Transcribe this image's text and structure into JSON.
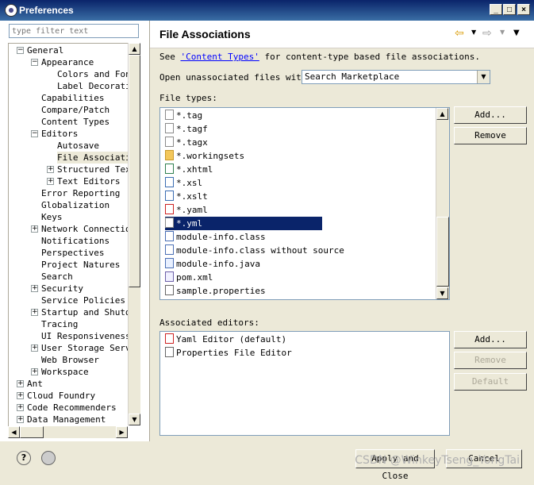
{
  "window": {
    "title": "Preferences"
  },
  "filter": {
    "placeholder": "type filter text"
  },
  "tree": [
    {
      "label": "General",
      "level": 0,
      "exp": "-"
    },
    {
      "label": "Appearance",
      "level": 1,
      "exp": "-"
    },
    {
      "label": "Colors and Fonts",
      "level": 2,
      "exp": ""
    },
    {
      "label": "Label Decorations",
      "level": 2,
      "exp": ""
    },
    {
      "label": "Capabilities",
      "level": 1,
      "exp": ""
    },
    {
      "label": "Compare/Patch",
      "level": 1,
      "exp": ""
    },
    {
      "label": "Content Types",
      "level": 1,
      "exp": ""
    },
    {
      "label": "Editors",
      "level": 1,
      "exp": "-"
    },
    {
      "label": "Autosave",
      "level": 2,
      "exp": ""
    },
    {
      "label": "File Associations",
      "level": 2,
      "exp": "",
      "selected": true
    },
    {
      "label": "Structured Text Editors",
      "level": 2,
      "exp": "+"
    },
    {
      "label": "Text Editors",
      "level": 2,
      "exp": "+"
    },
    {
      "label": "Error Reporting",
      "level": 1,
      "exp": ""
    },
    {
      "label": "Globalization",
      "level": 1,
      "exp": ""
    },
    {
      "label": "Keys",
      "level": 1,
      "exp": ""
    },
    {
      "label": "Network Connections",
      "level": 1,
      "exp": "+"
    },
    {
      "label": "Notifications",
      "level": 1,
      "exp": ""
    },
    {
      "label": "Perspectives",
      "level": 1,
      "exp": ""
    },
    {
      "label": "Project Natures",
      "level": 1,
      "exp": ""
    },
    {
      "label": "Search",
      "level": 1,
      "exp": ""
    },
    {
      "label": "Security",
      "level": 1,
      "exp": "+"
    },
    {
      "label": "Service Policies",
      "level": 1,
      "exp": ""
    },
    {
      "label": "Startup and Shutdown",
      "level": 1,
      "exp": "+"
    },
    {
      "label": "Tracing",
      "level": 1,
      "exp": ""
    },
    {
      "label": "UI Responsiveness",
      "level": 1,
      "exp": ""
    },
    {
      "label": "User Storage Service",
      "level": 1,
      "exp": "+"
    },
    {
      "label": "Web Browser",
      "level": 1,
      "exp": ""
    },
    {
      "label": "Workspace",
      "level": 1,
      "exp": "+"
    },
    {
      "label": "Ant",
      "level": 0,
      "exp": "+"
    },
    {
      "label": "Cloud Foundry",
      "level": 0,
      "exp": "+"
    },
    {
      "label": "Code Recommenders",
      "level": 0,
      "exp": "+"
    },
    {
      "label": "Data Management",
      "level": 0,
      "exp": "+"
    }
  ],
  "page": {
    "title": "File Associations",
    "see_prefix": "See ",
    "see_link": "'Content Types'",
    "see_suffix": " for content-type based file associations.",
    "open_label": "Open unassociated files with:",
    "open_value": "Search Marketplace",
    "filetypes_label": "File types:",
    "editors_label": "Associated editors:"
  },
  "file_types": [
    {
      "name": "*.tag",
      "icon": "text-file-icon"
    },
    {
      "name": "*.tagf",
      "icon": "text-file-icon"
    },
    {
      "name": "*.tagx",
      "icon": "text-file-icon"
    },
    {
      "name": "*.workingsets",
      "icon": "folder-icon"
    },
    {
      "name": "*.xhtml",
      "icon": "xhtml-file-icon"
    },
    {
      "name": "*.xsl",
      "icon": "xsl-file-icon"
    },
    {
      "name": "*.xslt",
      "icon": "xsl-file-icon"
    },
    {
      "name": "*.yaml",
      "icon": "yaml-icon"
    },
    {
      "name": "*.yml",
      "icon": "file-icon",
      "selected": true
    },
    {
      "name": "module-info.class",
      "icon": "class-file-icon"
    },
    {
      "name": "module-info.class without source",
      "icon": "class-file-icon"
    },
    {
      "name": "module-info.java",
      "icon": "java-file-icon"
    },
    {
      "name": "pom.xml",
      "icon": "maven-icon"
    },
    {
      "name": "sample.properties",
      "icon": "properties-file-icon"
    }
  ],
  "editors": [
    {
      "name": "Yaml Editor (default)",
      "icon": "yaml-icon"
    },
    {
      "name": "Properties File Editor",
      "icon": "properties-editor-icon"
    }
  ],
  "buttons": {
    "add1": "Add...",
    "remove1": "Remove",
    "add2": "Add...",
    "remove2": "Remove",
    "default": "Default",
    "apply_close": "Apply and Close",
    "cancel": "Cancel"
  },
  "watermark": "CSDN @WinkeyTseng_YongTai",
  "colors": {
    "titlebar": "#0a246a",
    "selection": "#0a246a",
    "yaml": "#cc2222"
  }
}
